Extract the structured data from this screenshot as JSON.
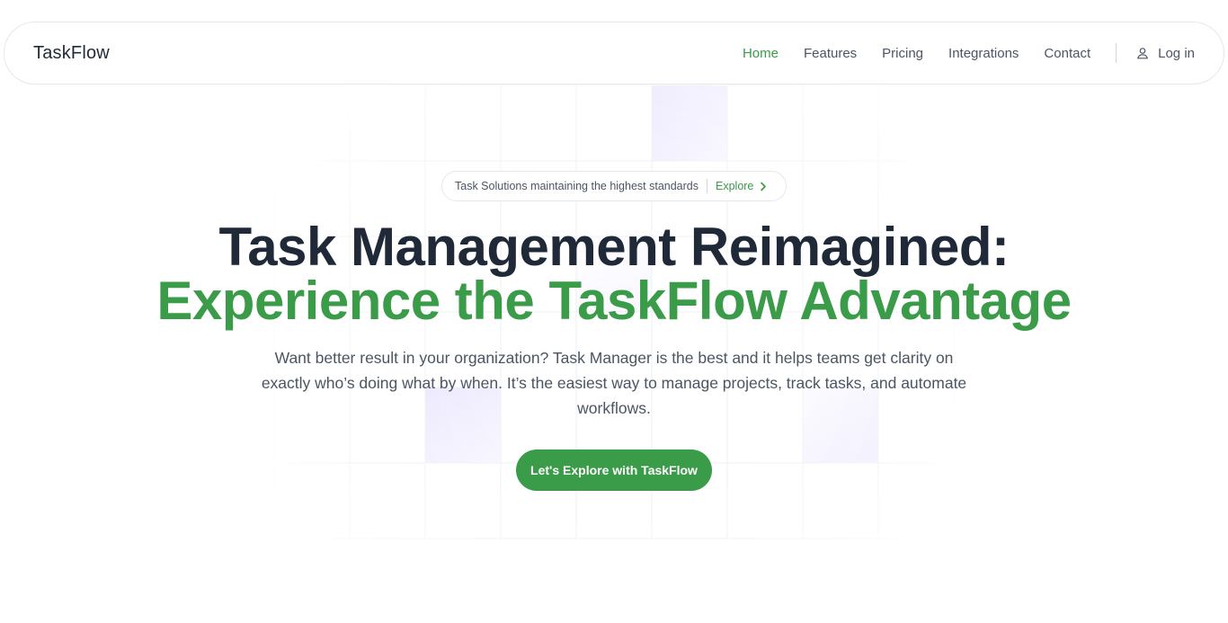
{
  "nav": {
    "brand": "TaskFlow",
    "links": [
      {
        "label": "Home",
        "active": true
      },
      {
        "label": "Features"
      },
      {
        "label": "Pricing"
      },
      {
        "label": "Integrations"
      },
      {
        "label": "Contact"
      }
    ],
    "login_label": "Log in",
    "login_icon": "user-icon"
  },
  "hero": {
    "badge_text": "Task Solutions maintaining the highest standards",
    "badge_link": "Explore",
    "badge_icon": "chevron-right-icon",
    "title_line1": "Task Management Reimagined:",
    "title_line2": "Experience the TaskFlow Advantage",
    "subtitle": "Want better result in your organization? Task Manager is the best and it helps teams get clarity on exactly who’s doing what by when. It’s the easiest way to manage projects, track tasks, and automate workflows.",
    "cta_label": "Let's Explore with TaskFlow"
  },
  "colors": {
    "accent": "#3a9b48",
    "heading": "#1f2937",
    "text": "#4b5563",
    "grid_highlight": "#ece9ff"
  }
}
